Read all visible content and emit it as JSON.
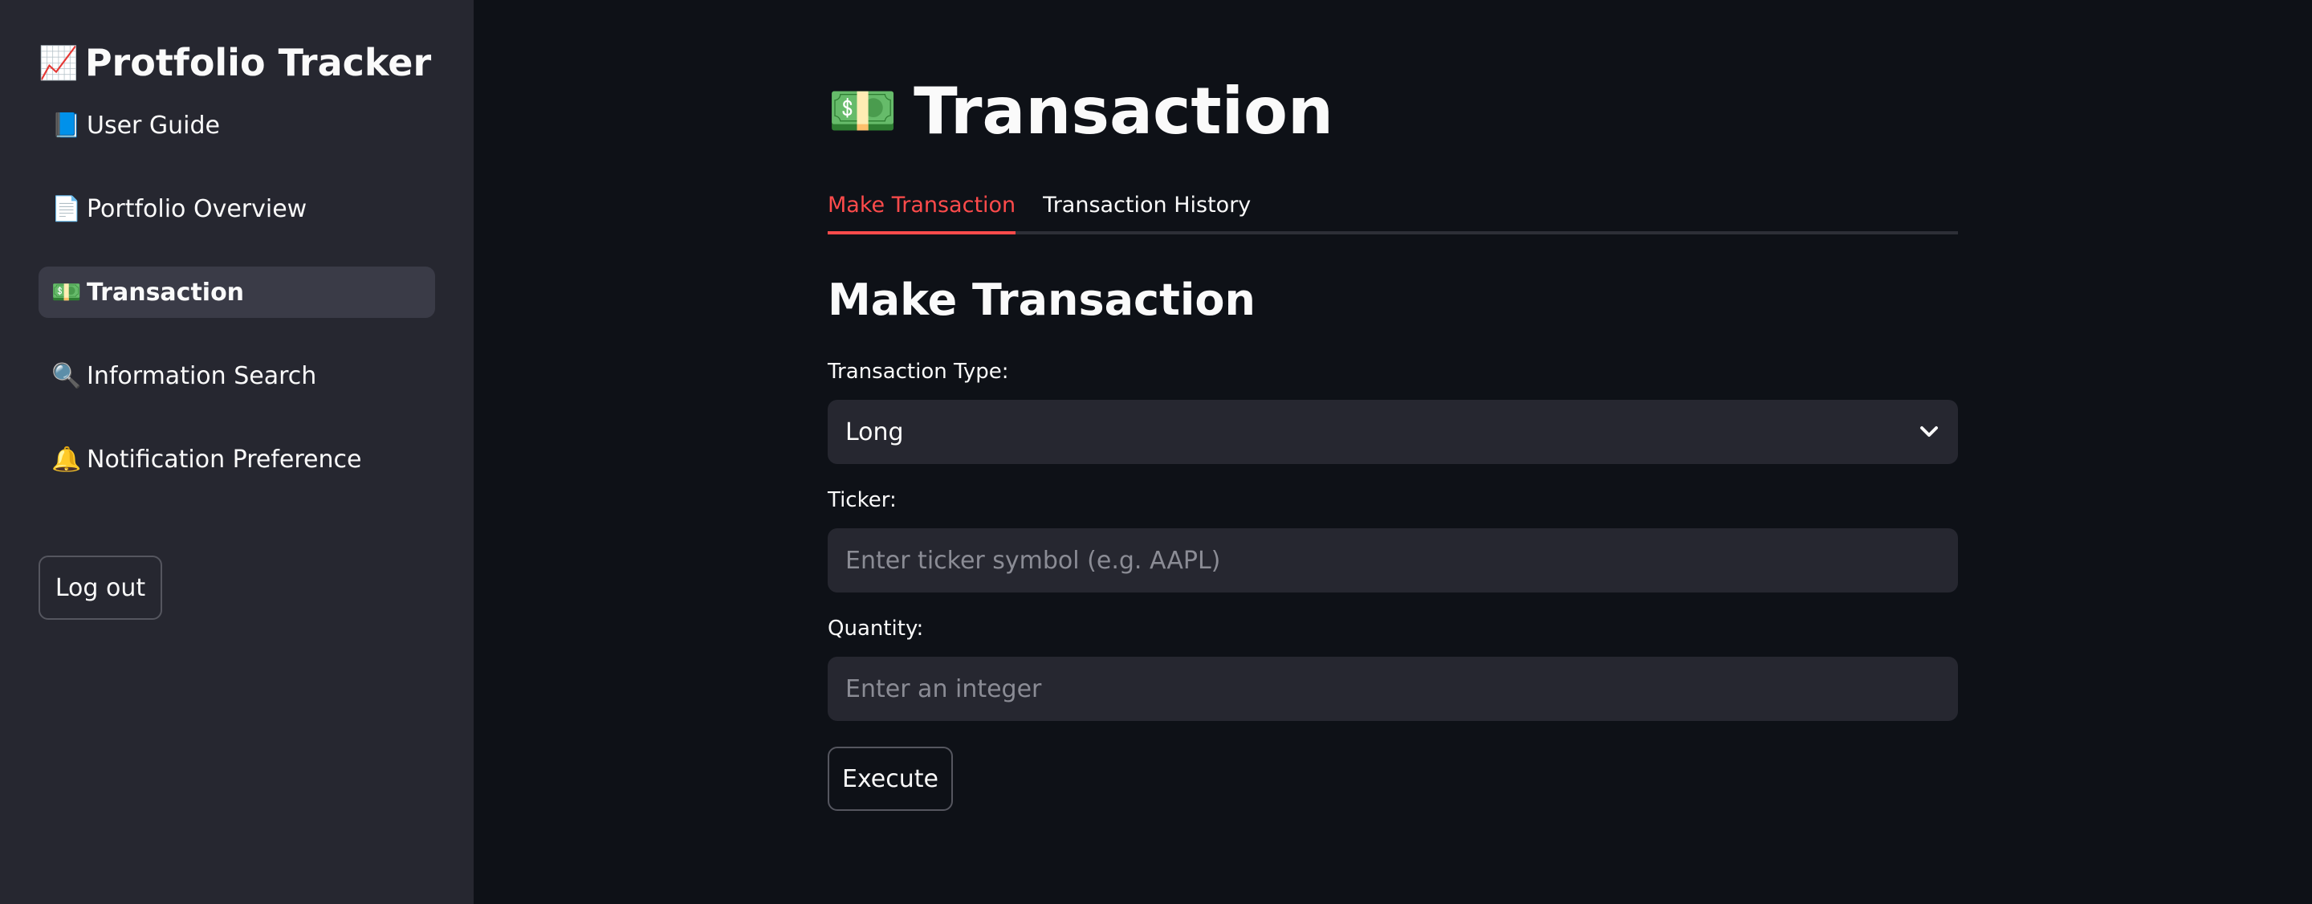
{
  "sidebar": {
    "app_title": "Protfolio Tracker",
    "app_icon": "📈",
    "items": [
      {
        "label": "User Guide",
        "icon": "📘",
        "active": false
      },
      {
        "label": "Portfolio Overview",
        "icon": "📄",
        "active": false
      },
      {
        "label": "Transaction",
        "icon": "💵",
        "active": true
      },
      {
        "label": "Information Search",
        "icon": "🔍",
        "active": false
      },
      {
        "label": "Notification Preference",
        "icon": "🔔",
        "active": false
      }
    ],
    "logout_label": "Log out"
  },
  "main": {
    "title": "Transaction",
    "title_icon": "💵",
    "tabs": [
      {
        "label": "Make Transaction",
        "active": true
      },
      {
        "label": "Transaction History",
        "active": false
      }
    ],
    "section_title": "Make Transaction",
    "form": {
      "type_label": "Transaction Type:",
      "type_value": "Long",
      "ticker_label": "Ticker:",
      "ticker_placeholder": "Enter ticker symbol (e.g. AAPL)",
      "quantity_label": "Quantity:",
      "quantity_placeholder": "Enter an integer",
      "execute_label": "Execute"
    }
  },
  "colors": {
    "sidebar_bg": "#262730",
    "main_bg": "#0e1117",
    "accent": "#ff4b4b",
    "input_bg": "#262730"
  }
}
